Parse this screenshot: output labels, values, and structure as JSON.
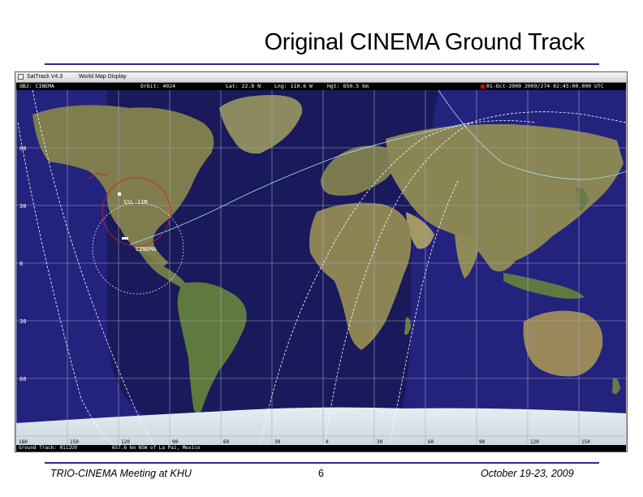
{
  "slide": {
    "title": "Original CINEMA Ground Track",
    "footer_left": "TRIO-CINEMA Meeting at KHU",
    "footer_page": "6",
    "footer_right": "October 19-23, 2009"
  },
  "window": {
    "app_title": "SatTrack V4.3",
    "title": "World Map Display"
  },
  "info": {
    "obj": "OBJ: CINEMA",
    "orbit": "Orbit: 4024",
    "lat": "Lat: 22.8 N",
    "lng": "Lng: 110.6 W",
    "hgt": "Hgt: 650.5 km",
    "datetime": "01-Oct-2009  2009/274  02:45:00.000 UTC"
  },
  "status": {
    "ground_track": "Ground Track: 0112UV",
    "position": "657.6 km NSW of La Paz, Mexico"
  },
  "map": {
    "lat_labels": [
      "60",
      "30",
      "0",
      "30",
      "60"
    ],
    "lon_labels": [
      "180",
      "150",
      "120",
      "90",
      "60",
      "30",
      "0",
      "30",
      "60",
      "90",
      "120",
      "150"
    ],
    "station_label": "SSL 11M",
    "sat_label": "CINEMA",
    "ocean_color": "#23237e",
    "grid_color": "#a6a6c4",
    "track_color": "#ffffff",
    "footprint_color": "#d02020"
  }
}
